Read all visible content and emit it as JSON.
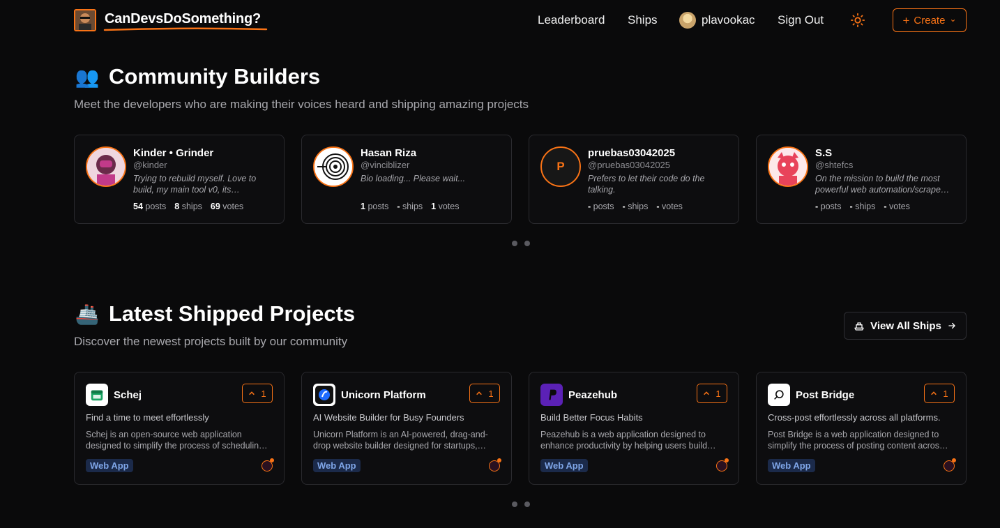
{
  "header": {
    "logo_text": "CanDevsDoSomething?",
    "nav": {
      "leaderboard": "Leaderboard",
      "ships": "Ships",
      "username": "plavookac",
      "sign_out": "Sign Out"
    },
    "create": {
      "plus": "+",
      "label": "Create",
      "chevron": "⌄"
    }
  },
  "builders": {
    "emoji": "👥",
    "title": "Community Builders",
    "subtitle": "Meet the developers who are making their voices heard and shipping amazing projects",
    "cards": [
      {
        "name": "Kinder • Grinder",
        "handle": "@kinder",
        "bio": "Trying to rebuild myself. Love to build, my main tool v0, its…",
        "posts": "54",
        "ships": "8",
        "votes": "69"
      },
      {
        "name": "Hasan Riza",
        "handle": "@vinciblizer",
        "bio": "Bio loading... Please wait...",
        "posts": "1",
        "ships": "-",
        "votes": "1"
      },
      {
        "name": "pruebas03042025",
        "handle": "@pruebas03042025",
        "initial": "P",
        "bio": "Prefers to let their code do the talking.",
        "posts": "-",
        "ships": "-",
        "votes": "-"
      },
      {
        "name": "S.S",
        "handle": "@shtefcs",
        "bio": "On the mission to build the most powerful web automation/scrape…",
        "posts": "-",
        "ships": "-",
        "votes": "-"
      }
    ],
    "labels": {
      "posts": "posts",
      "ships": "ships",
      "votes": "votes"
    }
  },
  "ships": {
    "emoji": "🚢",
    "title": "Latest Shipped Projects",
    "subtitle": "Discover the newest projects built by our community",
    "view_all": "View All Ships",
    "cards": [
      {
        "name": "Schej",
        "votes": "1",
        "tagline": "Find a time to meet effortlessly",
        "desc": "Schej is an open-source web application designed to simplify the process of schedulin…",
        "badge": "Web App"
      },
      {
        "name": "Unicorn Platform",
        "votes": "1",
        "tagline": "AI Website Builder for Busy Founders",
        "desc": "Unicorn Platform is an AI-powered, drag-and-drop website builder designed for startups,…",
        "badge": "Web App"
      },
      {
        "name": "Peazehub",
        "votes": "1",
        "tagline": "Build Better Focus Habits",
        "desc": "Peazehub is a web application designed to enhance productivity by helping users build…",
        "badge": "Web App"
      },
      {
        "name": "Post Bridge",
        "votes": "1",
        "tagline": "Cross-post effortlessly across all platforms.",
        "desc": "Post Bridge is a web application designed to simplify the process of posting content acros…",
        "badge": "Web App"
      }
    ]
  },
  "colors": {
    "accent": "#f97316",
    "background": "#0a0a0b",
    "card": "#0d0d0f",
    "badge_bg": "#1b2a4a",
    "badge_text": "#7fa6e8"
  }
}
